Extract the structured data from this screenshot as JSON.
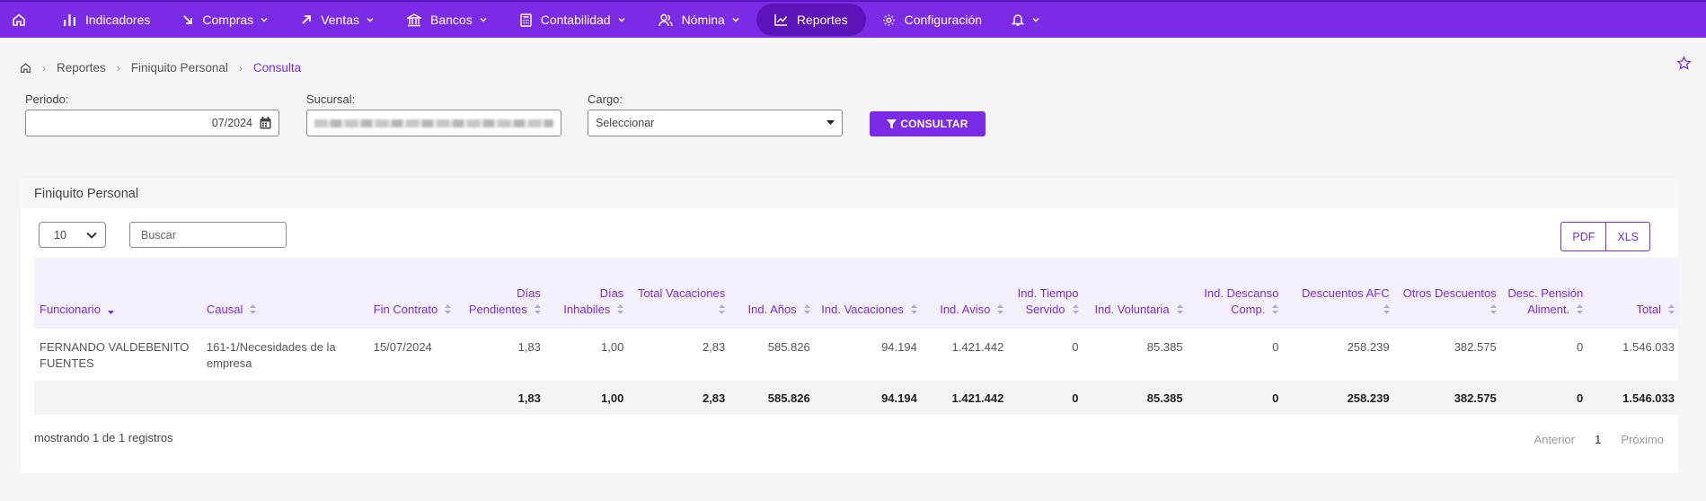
{
  "nav": {
    "items": [
      {
        "label": "Indicadores",
        "icon": "bar-chart-icon",
        "dropdown": false
      },
      {
        "label": "Compras",
        "icon": "arrow-down-right-icon",
        "dropdown": true
      },
      {
        "label": "Ventas",
        "icon": "arrow-up-right-icon",
        "dropdown": true
      },
      {
        "label": "Bancos",
        "icon": "bank-icon",
        "dropdown": true
      },
      {
        "label": "Contabilidad",
        "icon": "calculator-icon",
        "dropdown": true
      },
      {
        "label": "Nómina",
        "icon": "users-icon",
        "dropdown": true
      },
      {
        "label": "Reportes",
        "icon": "line-chart-icon",
        "dropdown": false,
        "active": true
      },
      {
        "label": "Configuración",
        "icon": "gear-icon",
        "dropdown": false
      }
    ],
    "accent": "#7b2be5"
  },
  "breadcrumb": {
    "items": [
      "Reportes",
      "Finiquito Personal"
    ],
    "current": "Consulta"
  },
  "filters": {
    "periodo_label": "Periodo:",
    "periodo_value": "07/2024",
    "sucursal_label": "Sucursal:",
    "cargo_label": "Cargo:",
    "cargo_value": "Seleccionar",
    "consultar_label": "CONSULTAR"
  },
  "card": {
    "title": "Finiquito Personal",
    "page_length": "10",
    "search_placeholder": "Buscar",
    "pdf_label": "PDF",
    "xls_label": "XLS"
  },
  "table": {
    "columns": [
      {
        "label": "Funcionario",
        "align": "l"
      },
      {
        "label": "Causal",
        "align": "l"
      },
      {
        "label": "Fin Contrato",
        "align": "l"
      },
      {
        "label": "Días Pendientes",
        "align": "r"
      },
      {
        "label": "Días Inhabiles",
        "align": "r"
      },
      {
        "label": "Total Vacaciones",
        "align": "r"
      },
      {
        "label": "Ind. Años",
        "align": "r"
      },
      {
        "label": "Ind. Vacaciones",
        "align": "r"
      },
      {
        "label": "Ind. Aviso",
        "align": "r"
      },
      {
        "label": "Ind. Tiempo Servido",
        "align": "r"
      },
      {
        "label": "Ind. Voluntaria",
        "align": "r"
      },
      {
        "label": "Ind. Descanso Comp.",
        "align": "r"
      },
      {
        "label": "Descuentos AFC",
        "align": "r"
      },
      {
        "label": "Otros Descuentos",
        "align": "r"
      },
      {
        "label": "Desc. Pensión Aliment.",
        "align": "r"
      },
      {
        "label": "Total",
        "align": "r"
      }
    ],
    "rows": [
      [
        "FERNANDO VALDEBENITO FUENTES",
        "161-1/Necesidades de la empresa",
        "15/07/2024",
        "1,83",
        "1,00",
        "2,83",
        "585.826",
        "94.194",
        "1.421.442",
        "0",
        "85.385",
        "0",
        "258.239",
        "382.575",
        "0",
        "1.546.033"
      ]
    ],
    "totals": [
      "",
      "",
      "",
      "1,83",
      "1,00",
      "2,83",
      "585.826",
      "94.194",
      "1.421.442",
      "0",
      "85.385",
      "0",
      "258.239",
      "382.575",
      "0",
      "1.546.033"
    ]
  },
  "footer": {
    "info": "mostrando 1 de 1 registros",
    "prev": "Anterior",
    "page": "1",
    "next": "Próximo"
  }
}
